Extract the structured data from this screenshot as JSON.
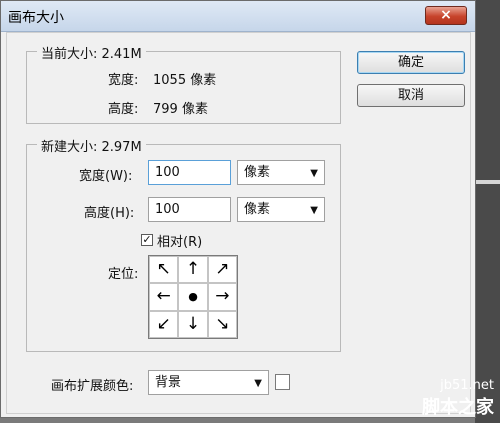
{
  "window": {
    "title": "画布大小",
    "close_icon": "×"
  },
  "current_size": {
    "legend": "当前大小: 2.41M",
    "width_label": "宽度:",
    "width_value": "1055 像素",
    "height_label": "高度:",
    "height_value": "799 像素"
  },
  "new_size": {
    "legend": "新建大小: 2.97M",
    "width_label": "宽度(W):",
    "width_value": "100",
    "width_unit": "像素",
    "height_label": "高度(H):",
    "height_value": "100",
    "height_unit": "像素",
    "relative_label": "相对(R)",
    "relative_checked": true,
    "anchor_label": "定位:",
    "anchor_arrows": [
      "↖",
      "↑",
      "↗",
      "←",
      "●",
      "→",
      "↙",
      "↓",
      "↘"
    ]
  },
  "buttons": {
    "ok": "确定",
    "cancel": "取消"
  },
  "extension": {
    "label": "画布扩展颜色:",
    "value": "背景"
  },
  "watermark": {
    "url": "jb51.net",
    "name": "脚本之家"
  }
}
